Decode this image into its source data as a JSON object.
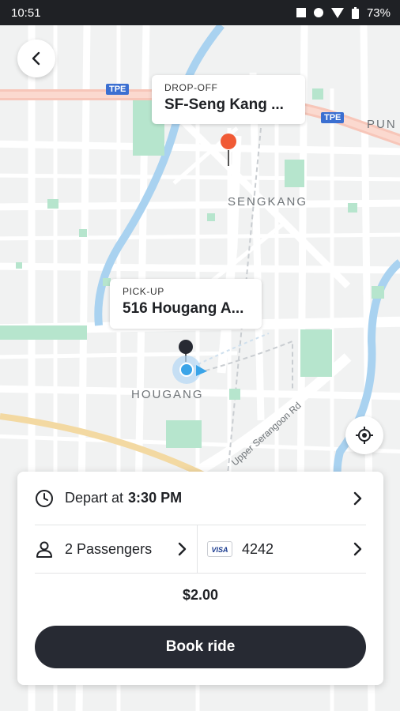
{
  "status_bar": {
    "time": "10:51",
    "battery": "73%"
  },
  "map": {
    "dropoff": {
      "label": "DROP-OFF",
      "value": "SF-Seng Kang ..."
    },
    "pickup": {
      "label": "PICK-UP",
      "value": "516 Hougang A..."
    },
    "labels": {
      "sengkang": "SENGKANG",
      "hougang": "HOUGANG",
      "pun": "PUN",
      "road": "Upper Serangoon Rd"
    },
    "expressway": {
      "tpe": "TPE"
    }
  },
  "sheet": {
    "depart_prefix": "Depart at",
    "depart_time": "3:30 PM",
    "passengers": "2 Passengers",
    "card_brand": "VISA",
    "card_last4": "4242",
    "price": "$2.00",
    "book_button": "Book ride"
  },
  "icons": {
    "back": "back-arrow-icon",
    "locate": "my-location-icon",
    "clock": "clock-icon",
    "person": "person-icon",
    "chevron": "chevron-right-icon"
  }
}
